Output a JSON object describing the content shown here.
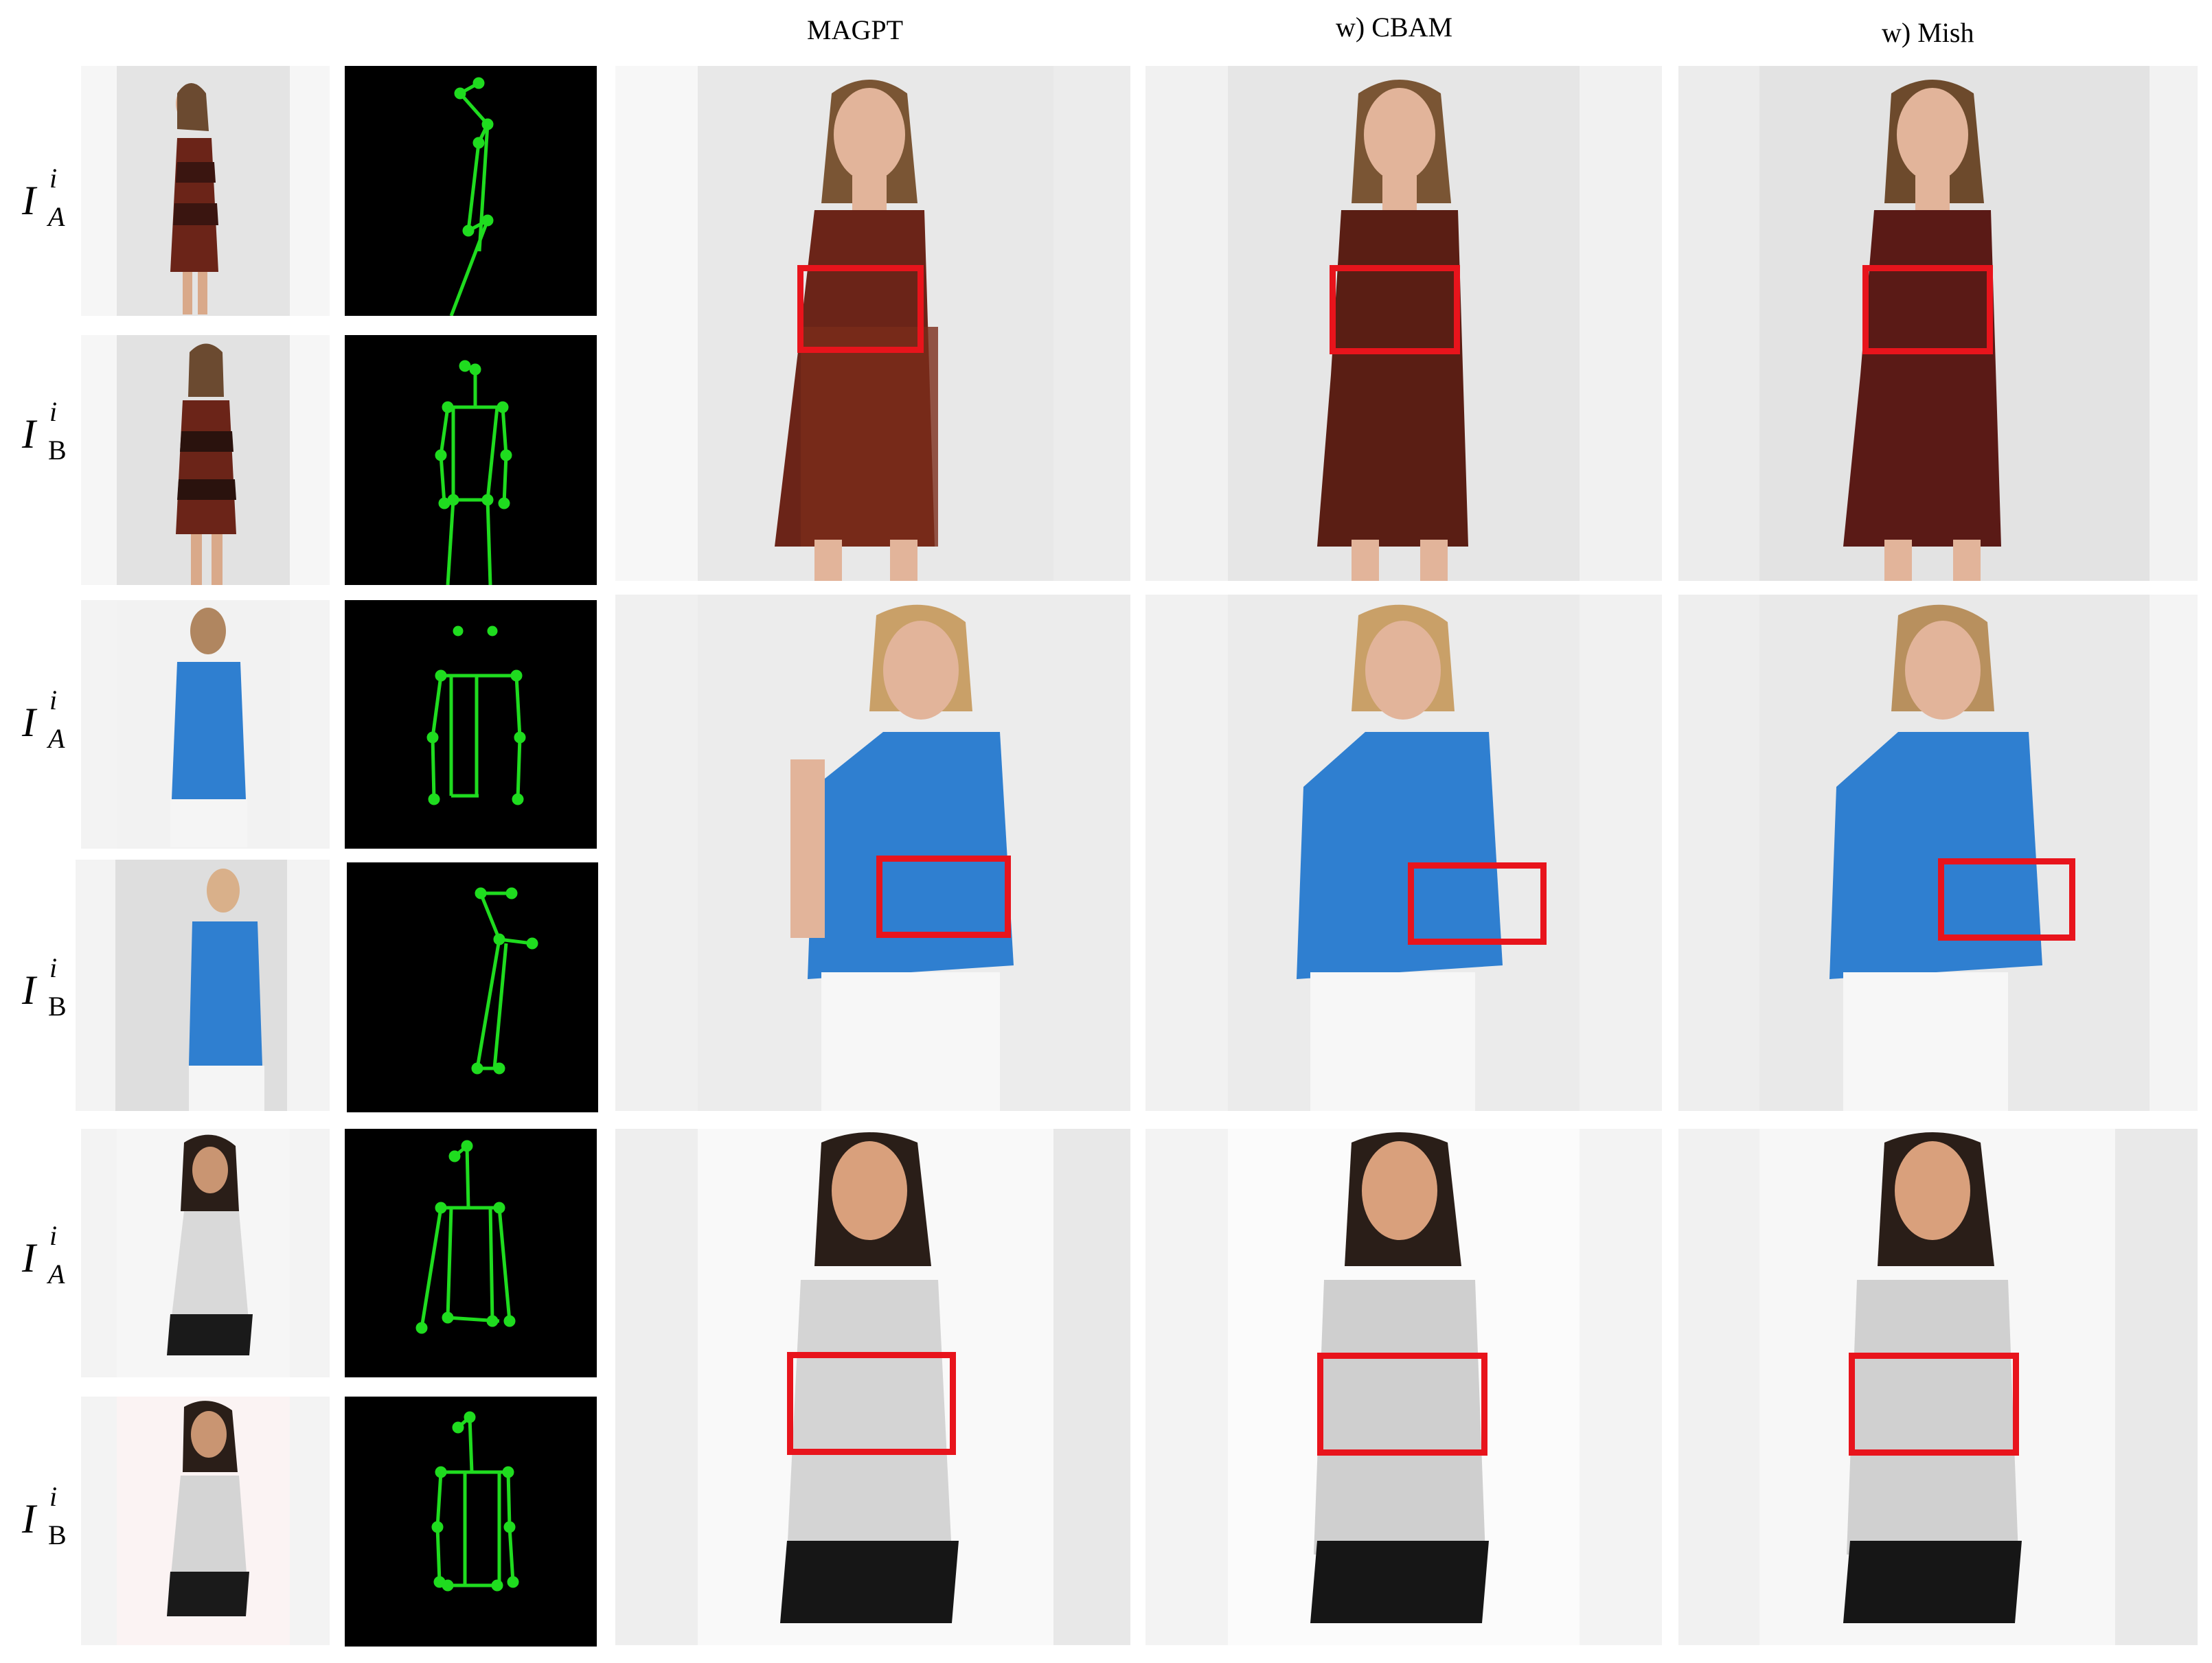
{
  "figure": {
    "columns": [
      "MAGPT",
      "w) CBAM",
      "w) Mish"
    ],
    "rows": [
      {
        "group": "red patterned dress",
        "labels": [
          {
            "base": "I",
            "sup": "i",
            "sub": "A"
          },
          {
            "base": "I",
            "sup": "i",
            "sub": "B"
          }
        ]
      },
      {
        "group": "blue sleeveless top",
        "labels": [
          {
            "base": "I",
            "sup": "i",
            "sub": "A"
          },
          {
            "base": "I",
            "sup": "i",
            "sub": "B"
          }
        ]
      },
      {
        "group": "black and white printed top",
        "labels": [
          {
            "base": "I",
            "sup": "i",
            "sub": "A"
          },
          {
            "base": "I",
            "sup": "i",
            "sub": "B"
          }
        ]
      }
    ],
    "colors": {
      "highlight_box": "#e8141c",
      "skeleton": "#1fdc1f",
      "pose_background": "#000000",
      "dress_red": "#6b2418",
      "top_blue": "#2f7fd0",
      "print_bw": "#d9d9d9"
    }
  }
}
